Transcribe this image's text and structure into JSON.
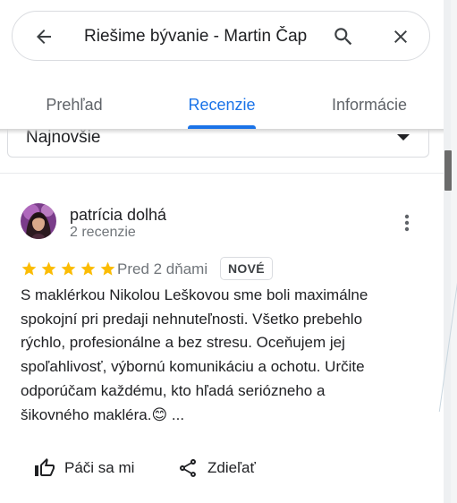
{
  "search": {
    "query": "Riešime bývanie - Martin Čap"
  },
  "tabs": [
    {
      "label": "Prehľad"
    },
    {
      "label": "Recenzie",
      "active": true
    },
    {
      "label": "Informácie"
    }
  ],
  "sort": {
    "selected": "Najnovšie"
  },
  "review": {
    "author": "patrícia dolhá",
    "author_meta": "2 recenzie",
    "rating_stars": 5,
    "date": "Pred 2 dňami",
    "badge": "NOVÉ",
    "text_lines": [
      "S maklérkou Nikolou Leškovou sme boli maximálne",
      "spokojní pri predaji nehnuteľnosti. Všetko prebehlo",
      "rýchlo, profesionálne a bez stresu. Oceňujem jej",
      "spoľahlivosť, výbornú komunikáciu a ochotu. Určite",
      "odporúčam každému, kto hľadá seriózneho a",
      "šikovného makléra.😊 ..."
    ]
  },
  "actions": {
    "like_label": "Páči sa mi",
    "share_label": "Zdieľať"
  },
  "colors": {
    "accent": "#1a73e8",
    "star": "#fbbc04",
    "text": "#202124",
    "muted": "#70757a"
  },
  "icons": [
    "back-arrow-icon",
    "search-icon",
    "close-icon",
    "more-vert-icon",
    "star-icon",
    "thumb-up-icon",
    "share-icon",
    "dropdown-caret-icon"
  ]
}
